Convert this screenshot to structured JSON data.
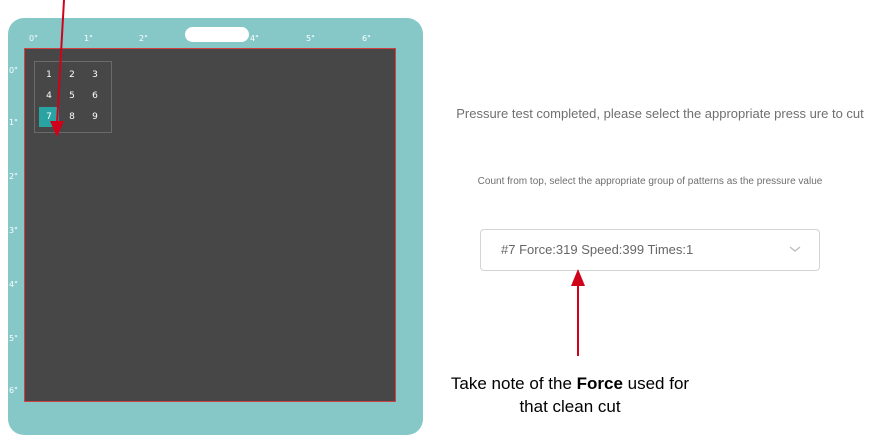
{
  "mat": {
    "ruler_top": [
      "0\"",
      "1\"",
      "2\"",
      "3\"",
      "4\"",
      "5\"",
      "6\""
    ],
    "ruler_left": [
      "0\"",
      "1\"",
      "2\"",
      "3\"",
      "4\"",
      "5\"",
      "6\""
    ],
    "pattern_cells": [
      "1",
      "2",
      "3",
      "4",
      "5",
      "6",
      "7",
      "8",
      "9"
    ],
    "selected_cell": "7"
  },
  "dialog": {
    "message": "Pressure test completed, please select the appropriate press ure to cut",
    "instruction": "Count from top, select the appropriate group of patterns as the pressure value",
    "pressure_select": {
      "value": "#7 Force:319 Speed:399 Times:1"
    }
  },
  "annotation": {
    "prefix": "Take note of the ",
    "bold": "Force",
    "suffix": " used for that clean cut"
  },
  "colors": {
    "mat": "#86c8c8",
    "cut_area": "#474747",
    "selected_cell": "#2aa3a3",
    "annotation_arrow": "#d0021b"
  }
}
